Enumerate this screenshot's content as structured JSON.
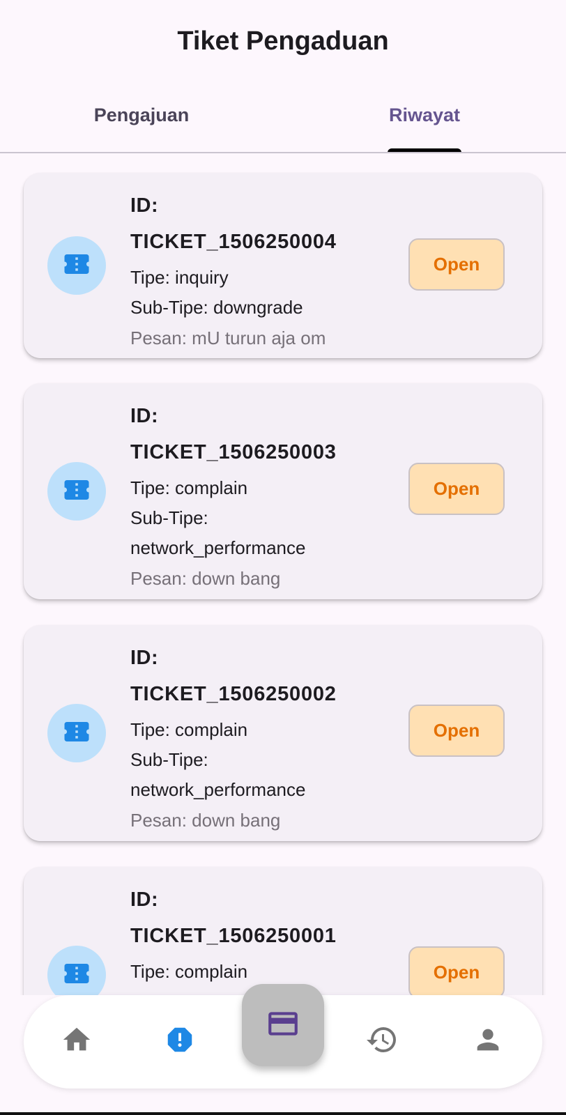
{
  "header": {
    "title": "Tiket Pengaduan"
  },
  "tabs": [
    {
      "label": "Pengajuan",
      "active": false
    },
    {
      "label": "Riwayat",
      "active": true
    }
  ],
  "tickets": [
    {
      "id_label": "ID:",
      "id": "TICKET_1506250004",
      "tipe": "Tipe: inquiry",
      "sub_line1": "Sub-Tipe: downgrade",
      "sub_line2": "",
      "pesan": "Pesan: mU turun aja om",
      "status": "Open"
    },
    {
      "id_label": "ID:",
      "id": "TICKET_1506250003",
      "tipe": "Tipe: complain",
      "sub_line1": "Sub-Tipe:",
      "sub_line2": "network_performance",
      "pesan": "Pesan: down bang",
      "status": "Open"
    },
    {
      "id_label": "ID:",
      "id": "TICKET_1506250002",
      "tipe": "Tipe: complain",
      "sub_line1": "Sub-Tipe:",
      "sub_line2": "network_performance",
      "pesan": "Pesan: down bang",
      "status": "Open"
    },
    {
      "id_label": "ID:",
      "id": "TICKET_1506250001",
      "tipe": "Tipe: complain",
      "sub_line1": "",
      "sub_line2": "",
      "pesan": "",
      "status": "Open"
    }
  ],
  "icons": {
    "ticket": "ticket-icon",
    "home": "home-icon",
    "report": "report-icon",
    "payment": "credit-card-icon",
    "history": "history-icon",
    "profile": "person-icon"
  },
  "colors": {
    "accent": "#65558f",
    "status_bg": "#ffe0b3",
    "status_text": "#e46f00",
    "icon_blue": "#1e88e5",
    "avatar_bg": "#bde0fb"
  }
}
